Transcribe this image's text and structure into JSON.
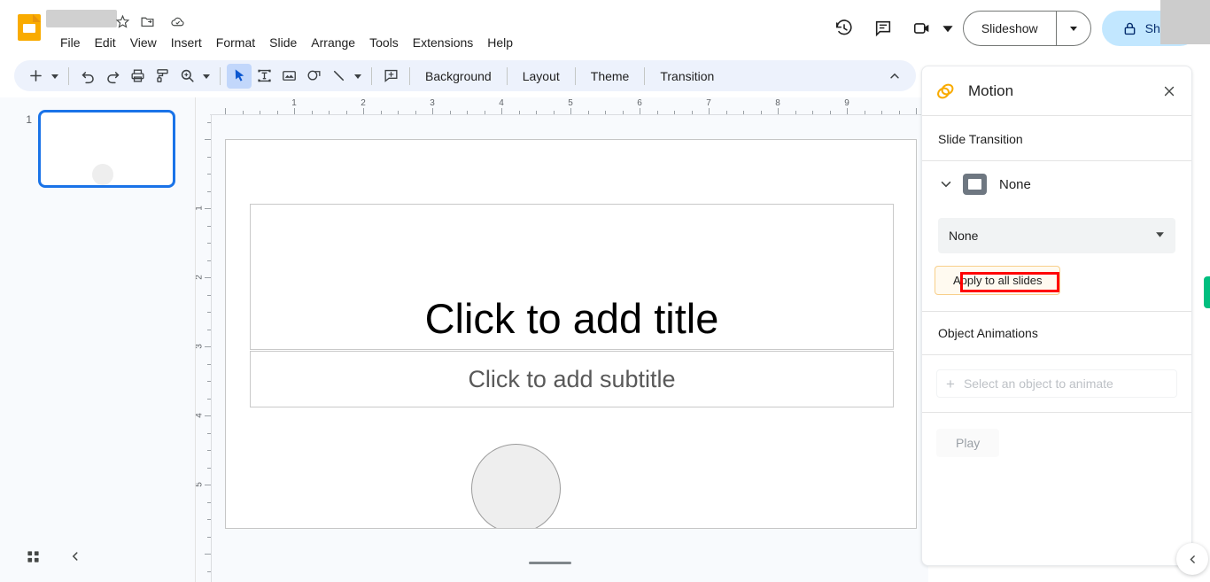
{
  "app": {
    "name": "Google Slides",
    "document_title": "",
    "logo_color": "#F9AB00"
  },
  "titlebar": {
    "icons": [
      {
        "name": "star-icon",
        "label": "Star"
      },
      {
        "name": "move-to-folder-icon",
        "label": "Move"
      },
      {
        "name": "cloud-saved-icon",
        "label": "Saved to Drive"
      }
    ]
  },
  "menubar": {
    "items": [
      {
        "label": "File"
      },
      {
        "label": "Edit"
      },
      {
        "label": "View"
      },
      {
        "label": "Insert"
      },
      {
        "label": "Format"
      },
      {
        "label": "Slide"
      },
      {
        "label": "Arrange"
      },
      {
        "label": "Tools"
      },
      {
        "label": "Extensions"
      },
      {
        "label": "Help"
      }
    ]
  },
  "header_actions": {
    "history_icon": "version-history-icon",
    "comment_icon": "comment-history-icon",
    "meet_icon": "google-meet-icon",
    "slideshow_label": "Slideshow",
    "share_label": "Share",
    "share_lock_icon": "lock-icon",
    "share_bg": "#C2E7FF"
  },
  "toolbar": {
    "buttons": [
      {
        "name": "new-slide-button",
        "icon": "plus-icon"
      },
      {
        "name": "undo-button",
        "icon": "undo-icon"
      },
      {
        "name": "redo-button",
        "icon": "redo-icon"
      },
      {
        "name": "print-button",
        "icon": "print-icon"
      },
      {
        "name": "paint-format-button",
        "icon": "paint-format-icon"
      },
      {
        "name": "zoom-button",
        "icon": "zoom-icon"
      },
      {
        "name": "select-tool-button",
        "icon": "cursor-icon"
      },
      {
        "name": "text-box-button",
        "icon": "text-box-icon"
      },
      {
        "name": "insert-image-button",
        "icon": "image-icon"
      },
      {
        "name": "shape-button",
        "icon": "shape-icon"
      },
      {
        "name": "line-button",
        "icon": "line-icon"
      },
      {
        "name": "comment-button",
        "icon": "add-comment-icon"
      }
    ],
    "text_buttons": [
      {
        "label": "Background"
      },
      {
        "label": "Layout"
      },
      {
        "label": "Theme"
      },
      {
        "label": "Transition"
      }
    ],
    "collapse_icon": "chevron-up-icon"
  },
  "filmstrip": {
    "slides": [
      {
        "number": "1",
        "selected": true
      }
    ],
    "grid_view_icon": "grid-view-icon",
    "collapse_icon": "chevron-left-icon"
  },
  "rulers": {
    "horizontal_ticks": [
      "1",
      "2",
      "3",
      "4",
      "5",
      "6",
      "7",
      "8",
      "9"
    ],
    "vertical_ticks": [
      "1",
      "2",
      "3",
      "4",
      "5"
    ]
  },
  "slide": {
    "title_placeholder": "Click to add title",
    "subtitle_placeholder": "Click to add subtitle",
    "shapes": [
      {
        "name": "circle-shape",
        "fill": "#eeeeee",
        "stroke": "#9b9b9b"
      }
    ]
  },
  "motion_panel": {
    "title": "Motion",
    "icon": "motion-icon",
    "close_icon": "close-icon",
    "slide_transition_header": "Slide Transition",
    "transition_row": {
      "chevron_icon": "chevron-down-icon",
      "thumb_icon": "transition-preview-icon",
      "name": "None"
    },
    "transition_select": {
      "value": "None",
      "caret_icon": "dropdown-caret-icon"
    },
    "apply_button": {
      "label": "Apply to all slides",
      "background": "#fffaf0",
      "border": "#f8cf8a",
      "highlight_color": "#ff0000"
    },
    "object_animations_header": "Object Animations",
    "select_object": {
      "label": "Select an object to animate",
      "plus_icon": "plus-icon",
      "disabled": true
    },
    "play_button": {
      "label": "Play",
      "disabled": true
    }
  },
  "edge": {
    "green_tab_color": "#00bf7f",
    "bottom_right_icon": "chevron-left-icon"
  }
}
